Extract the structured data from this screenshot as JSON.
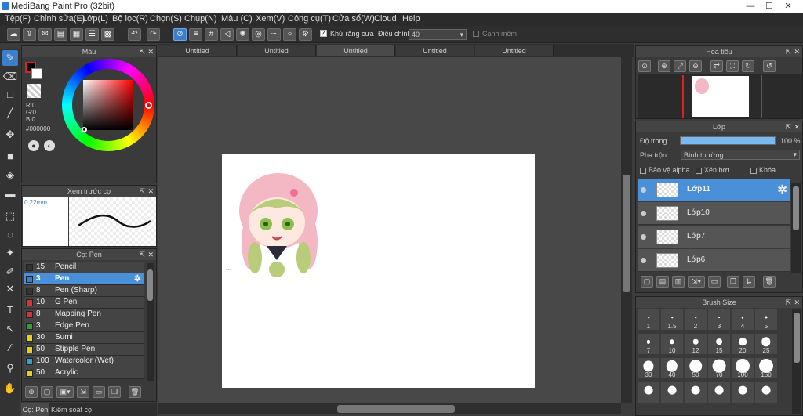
{
  "window": {
    "title": "MediBang Paint Pro (32bit)",
    "min": "—",
    "max": "☐",
    "close": "✕"
  },
  "menu": [
    "Tệp(F)",
    "Chỉnh sửa(E)",
    "Lớp(L)",
    "Bộ lọc(R)",
    "Chọn(S)",
    "Chụp(N)",
    "Màu (C)",
    "Xem(V)",
    "Công cụ(T)",
    "Cửa sổ(W)",
    "Cloud",
    "Help"
  ],
  "toolbar": {
    "antialias_label": "Khử răng cưa",
    "adjust_label": "Điều chỉnh",
    "adjust_value": "40",
    "edge_label": "Cạnh mềm"
  },
  "tabs": [
    "Untitled",
    "Untitled",
    "Untitled",
    "Untitled",
    "Untitled"
  ],
  "color_panel": {
    "title": "Màu",
    "r": "R:0",
    "g": "G:0",
    "b": "B:0",
    "hex": "#000000"
  },
  "preview_panel": {
    "title": "Xem trước cọ",
    "size": "0.22mm"
  },
  "brush_panel": {
    "title": "Cọ: Pen",
    "items": [
      {
        "size": "15",
        "name": "Pencil",
        "color": "#333333"
      },
      {
        "size": "3",
        "name": "Pen",
        "color": "#3b7ec9",
        "selected": true
      },
      {
        "size": "8",
        "name": "Pen (Sharp)",
        "color": "#333333"
      },
      {
        "size": "10",
        "name": "G Pen",
        "color": "#e03030"
      },
      {
        "size": "8",
        "name": "Mapping Pen",
        "color": "#e03030"
      },
      {
        "size": "3",
        "name": "Edge Pen",
        "color": "#30a030"
      },
      {
        "size": "30",
        "name": "Sumi",
        "color": "#e8d020"
      },
      {
        "size": "50",
        "name": "Stipple Pen",
        "color": "#e8d020"
      },
      {
        "size": "100",
        "name": "Watercolor (Wet)",
        "color": "#30a0d0"
      },
      {
        "size": "50",
        "name": "Acrylic",
        "color": "#e8d020"
      }
    ]
  },
  "bottom_tabs": [
    "Cọ: Pen",
    "Kiểm soát cọ"
  ],
  "navigator": {
    "title": "Hoa tiêu"
  },
  "layers_panel": {
    "title": "Lớp",
    "opacity_label": "Độ trong",
    "opacity_value": "100 %",
    "blend_label": "Pha trộn",
    "blend_value": "Bình thường",
    "protect_alpha": "Bảo vệ alpha",
    "clip": "Xén bớt",
    "lock": "Khóa",
    "layers": [
      {
        "name": "Lớp11",
        "selected": true
      },
      {
        "name": "Lớp10"
      },
      {
        "name": "Lớp7"
      },
      {
        "name": "Lớp6"
      }
    ]
  },
  "brush_size_panel": {
    "title": "Brush Size",
    "sizes": [
      "1",
      "1.5",
      "2",
      "3",
      "4",
      "5",
      "7",
      "10",
      "12",
      "15",
      "20",
      "25",
      "30",
      "40",
      "50",
      "70",
      "100",
      "150",
      "",
      "",
      "",
      "",
      "",
      ""
    ]
  },
  "colors": {
    "accent": "#4a90d9",
    "canvas_bg": "#484848",
    "panel_bg": "#3a3a3a"
  }
}
